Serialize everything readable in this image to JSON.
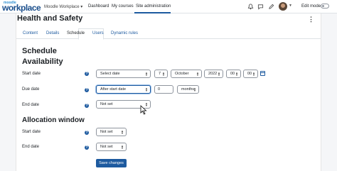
{
  "brand": {
    "small": "moodle",
    "big": "workplace"
  },
  "nav": {
    "dropdown": "Moodle Workplace ▾",
    "links": [
      "Dashboard",
      "My courses",
      "Site administration"
    ],
    "edit_mode": "Edit mode"
  },
  "page": {
    "title": "Health and Safety",
    "tabs": [
      "Content",
      "Details",
      "Schedule",
      "Users",
      "Dynamic rules"
    ],
    "active_tab": "Schedule"
  },
  "schedule": {
    "heading": "Schedule",
    "availability_heading": "Availability",
    "start_date": {
      "label": "Start date",
      "select": "Select date",
      "day": "7",
      "month": "October",
      "year": "2022",
      "hour": "00",
      "minute": "00"
    },
    "due_date": {
      "label": "Due date",
      "select": "After start date",
      "amount": "0",
      "unit": "months"
    },
    "end_date": {
      "label": "End date",
      "select": "Not set"
    }
  },
  "allocation": {
    "heading": "Allocation window",
    "start_date": {
      "label": "Start date",
      "select": "Not set"
    },
    "end_date": {
      "label": "End date",
      "select": "Not set"
    }
  },
  "save_label": "Save changes",
  "colors": {
    "primary": "#1d5a9f",
    "brand_dark": "#1b4f8c"
  }
}
